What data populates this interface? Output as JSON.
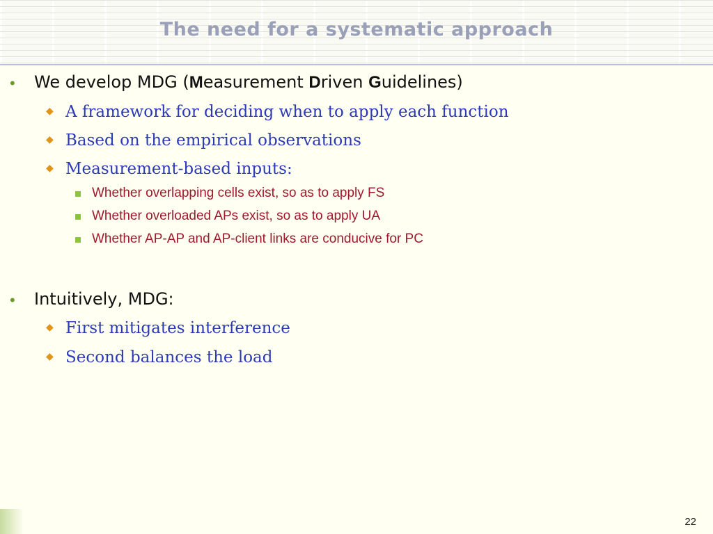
{
  "slide": {
    "title": "The need for a systematic approach",
    "page_number": "22"
  },
  "bullets": [
    {
      "pre": "We develop MDG (",
      "m_bold": "M",
      "m_rest": "easurement ",
      "d_bold": "D",
      "d_rest": "riven ",
      "g_bold": "G",
      "g_rest": "uidelines)"
    },
    {
      "text": "Intuitively, MDG:"
    }
  ],
  "sub_items_1": [
    "A framework for deciding when to apply each function",
    "Based on the empirical observations",
    "Measurement-based inputs:"
  ],
  "sub_sub_items": [
    "Whether overlapping cells exist, so as to apply FS",
    "Whether overloaded APs exist, so as to apply UA",
    "Whether AP-AP and AP-client links are conducive for PC"
  ],
  "sub_items_2": [
    "First mitigates interference",
    "Second balances the load"
  ],
  "colors": {
    "title": "#9aa0b8",
    "level1_bullet": "#6a9a2a",
    "level2_bullet": "#e09418",
    "level2_text": "#2c3ab4",
    "level3_bullet": "#8cc43c",
    "level3_text": "#a0182c",
    "background": "#fffff2"
  }
}
